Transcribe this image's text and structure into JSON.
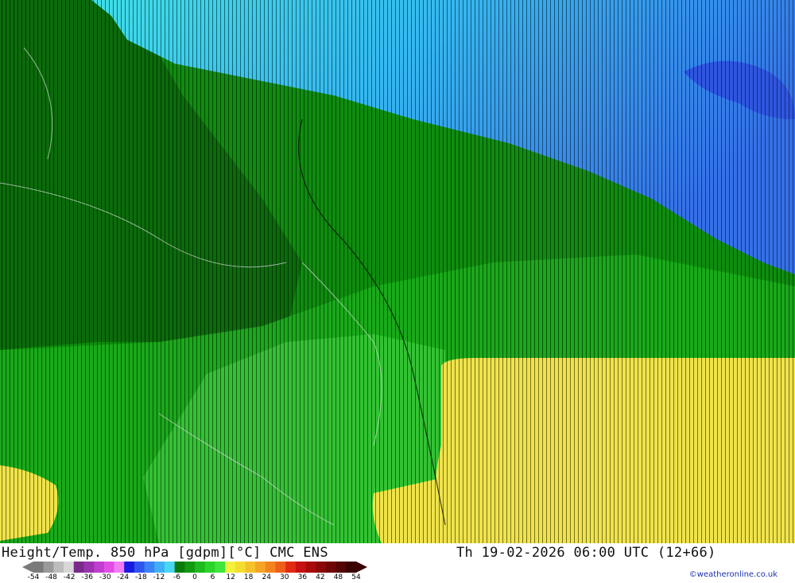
{
  "map": {
    "title": "Height/Temp. 850 hPa [gdpm][°C] CMC ENS",
    "valid_time": "Th 19-02-2026 06:00 UTC (12+66)",
    "credit": "©weatheronline.co.uk"
  },
  "legend": {
    "ticks": [
      "-54",
      "-48",
      "-42",
      "-36",
      "-30",
      "-24",
      "-18",
      "-12",
      "-6",
      "0",
      "6",
      "12",
      "18",
      "24",
      "30",
      "36",
      "42",
      "48",
      "54"
    ],
    "colors": [
      "#7a7a7a",
      "#9a9a9a",
      "#bdbdbd",
      "#d8d8d8",
      "#7a2b8a",
      "#9b32b0",
      "#bf3dd0",
      "#e04ee6",
      "#f27cf5",
      "#1a1ae0",
      "#2f54f0",
      "#3a82f5",
      "#3fb0f7",
      "#48d8f5",
      "#0a7a0a",
      "#129a12",
      "#1dbb1d",
      "#2ad52a",
      "#3ee63e",
      "#f2f23a",
      "#f5dd30",
      "#f5c22a",
      "#f5a424",
      "#f2841e",
      "#ee5f18",
      "#e22a12",
      "#c81010",
      "#a80a0a",
      "#8a0808",
      "#6e0606",
      "#550404",
      "#3a0202"
    ],
    "palette": {
      "dark_green": "#0b6b0b",
      "mid_green": "#0f8c0f",
      "green": "#1aa91a",
      "light_green": "#3fd23f",
      "cyan": "#3fe0e6",
      "sky_blue": "#36a6ec",
      "blue": "#3563e6",
      "yellow": "#f0e34a"
    }
  }
}
